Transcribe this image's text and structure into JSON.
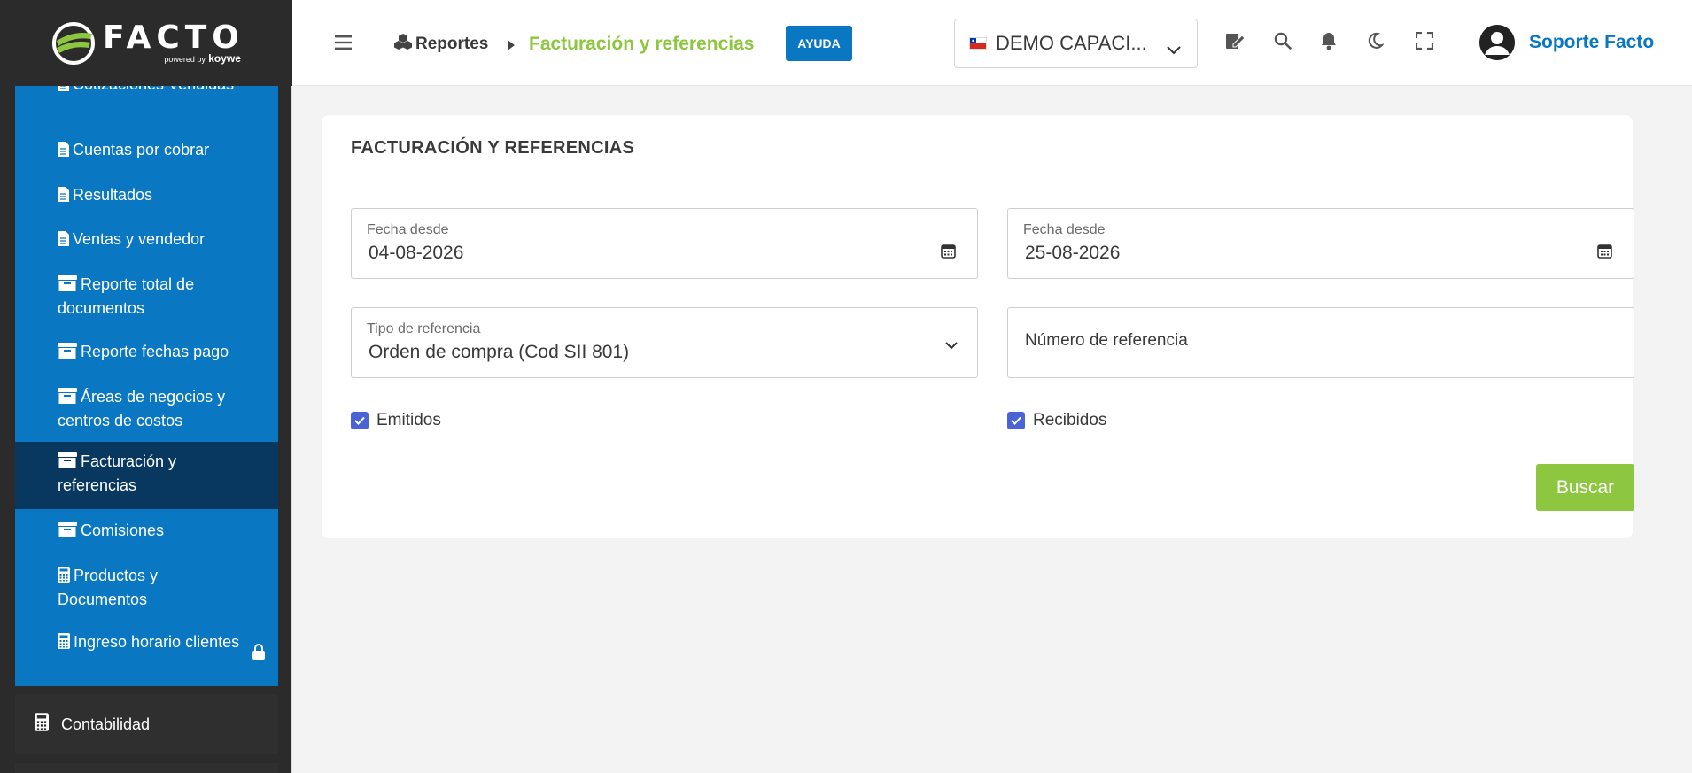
{
  "logo": {
    "word": "FACTO",
    "powered": "powered by",
    "brand": "koywe"
  },
  "sidebar": {
    "items": [
      {
        "label": "Cotizaciones Vendidas",
        "icon": "document-icon"
      },
      {
        "label": "Cuentas por cobrar",
        "icon": "document-icon"
      },
      {
        "label": "Resultados",
        "icon": "document-icon"
      },
      {
        "label": "Ventas y vendedor",
        "icon": "document-icon"
      },
      {
        "label": "Reporte total de documentos",
        "icon": "archive-icon"
      },
      {
        "label": "Reporte fechas pago",
        "icon": "archive-icon"
      },
      {
        "label": "Áreas de negocios y centros de costos",
        "icon": "archive-icon"
      },
      {
        "label": "Facturación y referencias",
        "icon": "archive-icon",
        "active": true
      },
      {
        "label": "Comisiones",
        "icon": "archive-icon"
      },
      {
        "label": "Productos y Documentos",
        "icon": "calculator-icon"
      },
      {
        "label": "Ingreso horario clientes",
        "icon": "calculator-icon",
        "locked": true
      }
    ],
    "section": {
      "label": "Contabilidad",
      "icon": "calculator-icon"
    }
  },
  "header": {
    "breadcrumb_root": "Reportes",
    "breadcrumb_current": "Facturación y referencias",
    "help_label": "AYUDA",
    "company": "DEMO CAPACI...",
    "user_name": "Soporte Facto"
  },
  "main": {
    "title": "FACTURACIÓN Y REFERENCIAS",
    "date_from": {
      "label": "Fecha desde",
      "value": "04-08-2026"
    },
    "date_to": {
      "label": "Fecha desde",
      "value": "25-08-2026"
    },
    "ref_type": {
      "label": "Tipo de referencia",
      "value": "Orden de compra (Cod SII 801)"
    },
    "ref_number": {
      "placeholder": "Número de referencia"
    },
    "emitidos": {
      "label": "Emitidos",
      "checked": true
    },
    "recibidos": {
      "label": "Recibidos",
      "checked": true
    },
    "search_label": "Buscar"
  },
  "colors": {
    "brand_blue": "#0a77c3",
    "accent_green": "#8dc63f",
    "sidebar_dark": "#2b2b2b",
    "active_item": "#08385f",
    "checkbox": "#4a64d6"
  }
}
